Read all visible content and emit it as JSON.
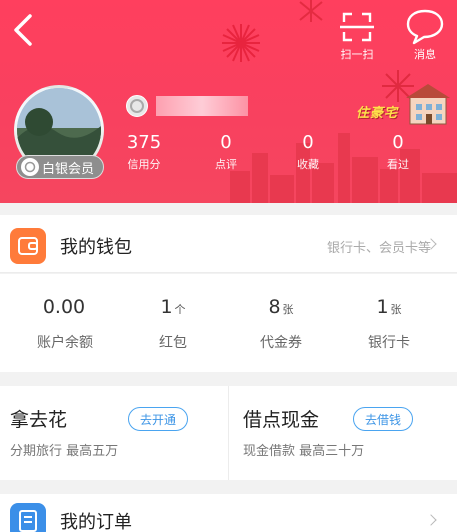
{
  "header": {
    "scan_label": "扫一扫",
    "message_label": "消息",
    "member_badge": "白银会员",
    "lives_badge_text": "住豪宅",
    "stats": [
      {
        "value": "375",
        "label": "信用分"
      },
      {
        "value": "0",
        "label": "点评"
      },
      {
        "value": "0",
        "label": "收藏"
      },
      {
        "value": "0",
        "label": "看过"
      }
    ],
    "colors": {
      "header_red": "#f8415f",
      "accent_blue": "#3d95e6",
      "wallet_orange": "#ff7b3a"
    }
  },
  "wallet": {
    "title": "我的钱包",
    "link": "银行卡、会员卡等",
    "items": [
      {
        "value": "0.00",
        "unit": "",
        "label": "账户余额"
      },
      {
        "value": "1",
        "unit": "个",
        "label": "红包"
      },
      {
        "value": "8",
        "unit": "张",
        "label": "代金券"
      },
      {
        "value": "1",
        "unit": "张",
        "label": "银行卡"
      }
    ]
  },
  "loans": [
    {
      "title": "拿去花",
      "button": "去开通",
      "subtitle": "分期旅行 最高五万"
    },
    {
      "title": "借点现金",
      "button": "去借钱",
      "subtitle": "现金借款 最高三十万"
    }
  ],
  "orders": {
    "title": "我的订单"
  },
  "icons": {
    "back": "back-arrow-icon",
    "scan": "scan-icon",
    "message": "message-bubble-icon",
    "wallet": "wallet-icon",
    "order": "order-list-icon"
  }
}
